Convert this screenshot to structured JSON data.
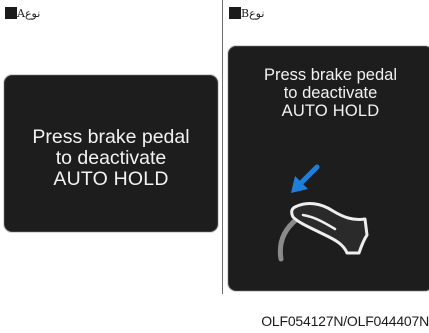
{
  "panel_a": {
    "label": "نوعA",
    "message": [
      "Press brake pedal",
      "to deactivate",
      "AUTO HOLD"
    ]
  },
  "panel_b": {
    "label": "نوعB",
    "message": [
      "Press brake pedal",
      "to deactivate",
      "AUTO HOLD"
    ],
    "icon": "brake-pedal-press-icon"
  },
  "footer": {
    "code": "OLF054127N/OLF044407N"
  },
  "colors": {
    "screen_bg": "#1d1d1d",
    "screen_text": "#f2f2f2",
    "arrow_blue": "#1f7fd8"
  }
}
